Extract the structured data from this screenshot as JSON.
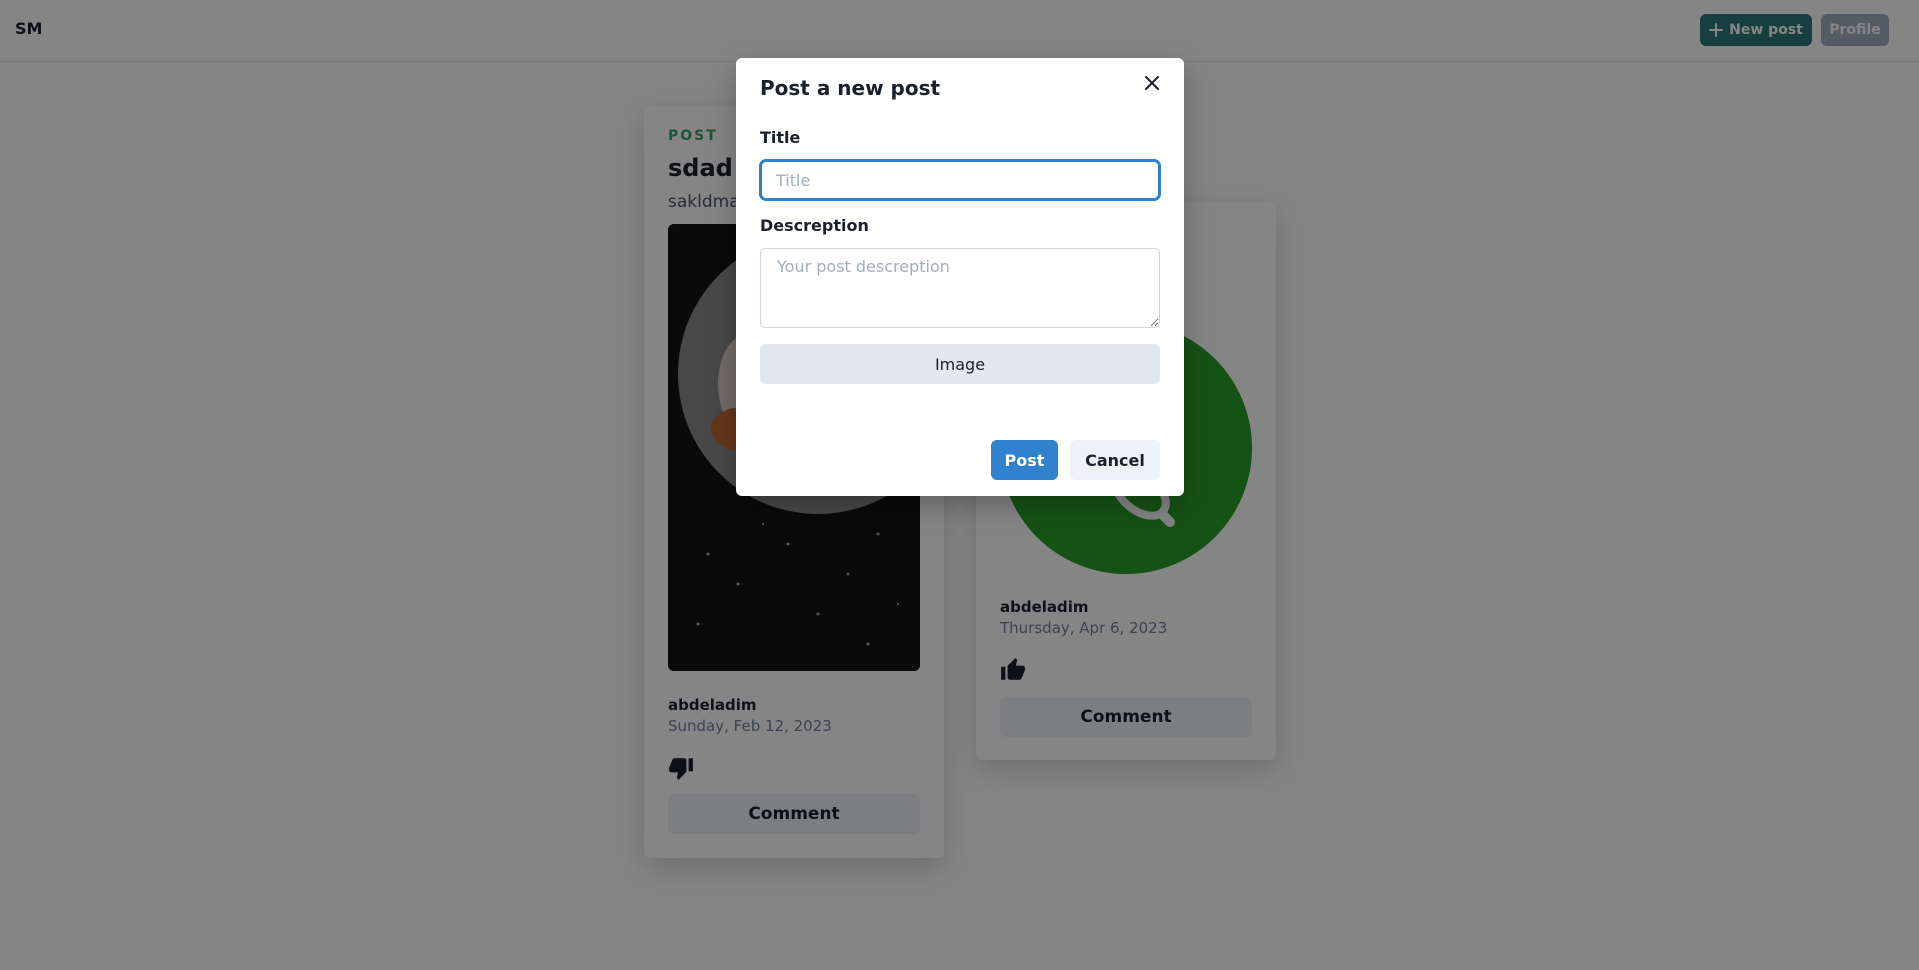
{
  "header": {
    "logo": "SM",
    "new_post_label": "New post",
    "profile_label": "Profile"
  },
  "posts": [
    {
      "kicker": "POST",
      "title": "sdad",
      "description": "sakldma",
      "image_icon": "astronaut-moon-image",
      "author": "abdeladim",
      "date": "Sunday, Feb 12, 2023",
      "reaction_icon": "thumbs-down-icon",
      "comment_label": "Comment"
    },
    {
      "image_icon": "green-circle-image",
      "author": "abdeladim",
      "date": "Thursday, Apr 6, 2023",
      "reaction_icon": "thumbs-up-icon",
      "comment_label": "Comment",
      "image_color": "#2a9d2a"
    }
  ],
  "modal": {
    "title": "Post a new post",
    "title_label": "Title",
    "title_value": "",
    "title_placeholder": "Title",
    "description_label": "Descreption",
    "description_value": "",
    "description_placeholder": "Your post descreption",
    "image_button_label": "Image",
    "post_button_label": "Post",
    "cancel_button_label": "Cancel"
  },
  "colors": {
    "teal": "#2c7a7b",
    "blue": "#3182ce",
    "green": "#38a169",
    "overlay": "rgba(0,0,0,0.48)"
  }
}
